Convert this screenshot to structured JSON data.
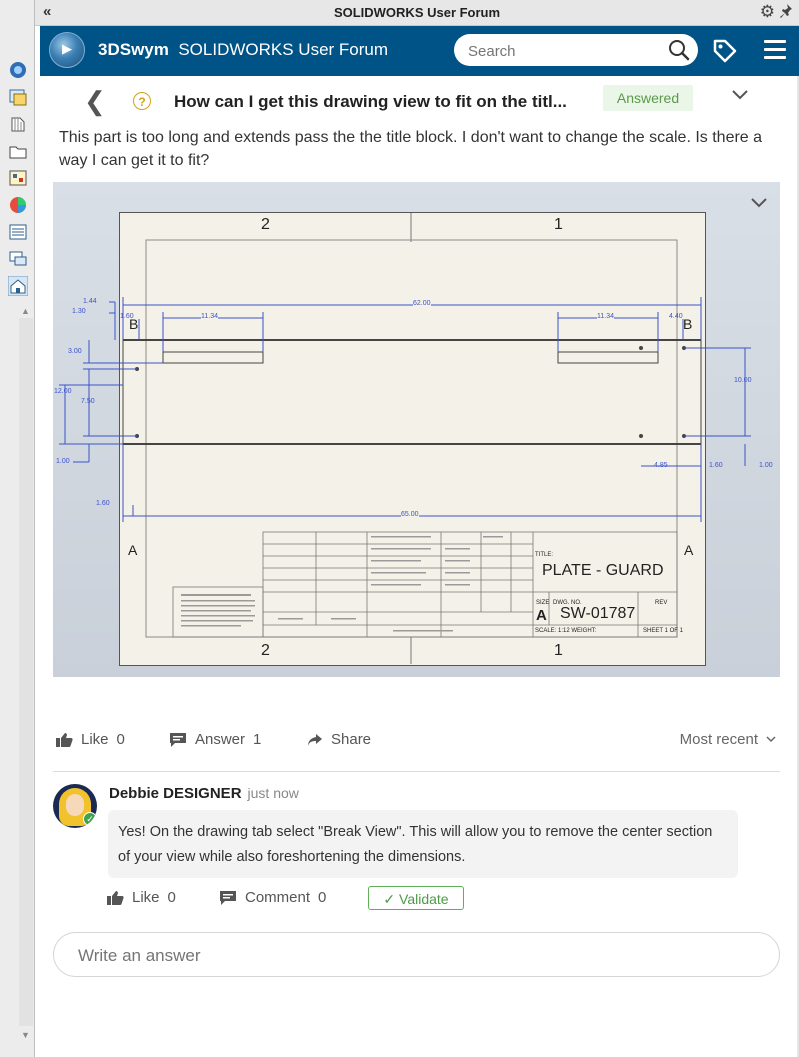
{
  "window": {
    "title": "SOLIDWORKS User Forum",
    "collapse_glyph": "«",
    "icons": [
      "gear-icon",
      "pin-icon"
    ]
  },
  "task_pane": {
    "tools": [
      "solidworks-resources-icon",
      "design-library-icon",
      "file-explorer-icon",
      "view-palette-icon",
      "appearances-icon",
      "custom-properties-icon",
      "forum-icon",
      "home-icon"
    ]
  },
  "header": {
    "brand_bold": "3DSwym",
    "brand_rest": "SOLIDWORKS User Forum",
    "search_placeholder": "Search",
    "colors": {
      "bar": "#005386"
    }
  },
  "question": {
    "title": "How can I get this drawing view to fit on the titl...",
    "status": "Answered",
    "body": "This part is too long and extends pass the the title block.  I don't want to change the scale.  Is there a way I can get it to fit?"
  },
  "drawing": {
    "zone_top_left": "2",
    "zone_top_right": "1",
    "zone_bottom_left": "2",
    "zone_bottom_right": "1",
    "row_left": "A",
    "row_right": "A",
    "section_left": "B",
    "section_right": "B",
    "dims": {
      "overall_top": "62.00",
      "overall_bottom": "65.00",
      "slot_left": "11.34",
      "slot_right": "11.34",
      "left_1_44": "1.44",
      "left_1_30": "1.30",
      "left_1_60a": "1.60",
      "left_3_00": "3.00",
      "left_12_00": "12.00",
      "left_7_50": "7.50",
      "left_1_00": "1.00",
      "left_1_60b": "1.60",
      "right_4_40": "4.40",
      "right_10_00": "10.00",
      "right_4_85": "4.85",
      "right_1_60": "1.60",
      "right_1_00": "1.00"
    },
    "title_block": {
      "title_label": "TITLE:",
      "part_title": "PLATE - GUARD",
      "size_label": "SIZE",
      "dwg_label": "DWG.  NO.",
      "rev_label": "REV",
      "size": "A",
      "dwg_no": "SW-01787",
      "scale": "SCALE: 1:12 WEIGHT:",
      "sheet": "SHEET 1 OF 1"
    }
  },
  "actions": {
    "like_label": "Like",
    "like_count": "0",
    "answer_label": "Answer",
    "answer_count": "1",
    "share_label": "Share",
    "sort_label": "Most recent"
  },
  "answer": {
    "author": "Debbie DESIGNER",
    "time": "just now",
    "text": "Yes!  On the drawing tab select \"Break View\".  This will allow you to remove the center section of your view while also foreshortening the dimensions.",
    "like_label": "Like",
    "like_count": "0",
    "comment_label": "Comment",
    "comment_count": "0",
    "validate_label": "Validate"
  },
  "compose": {
    "placeholder": "Write an answer"
  }
}
